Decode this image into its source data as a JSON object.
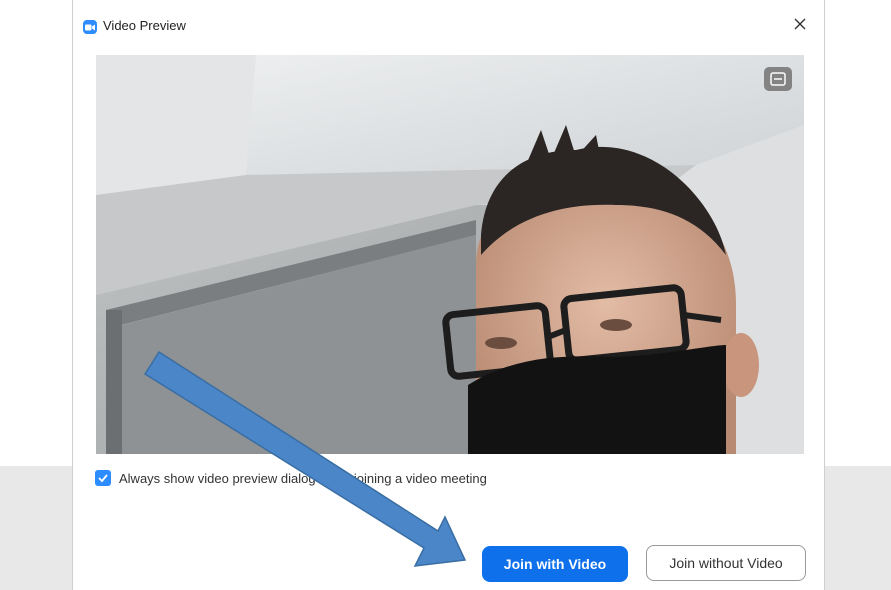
{
  "window": {
    "title": "Video Preview",
    "app_icon": "zoom-camera-icon",
    "close_icon": "close-icon"
  },
  "video_preview": {
    "toggle_icon": "layout-toggle-icon"
  },
  "options": {
    "always_show_preview_label": "Always show video preview dialog when joining a video meeting",
    "always_show_preview_checked": true
  },
  "buttons": {
    "join_with_video": "Join with Video",
    "join_without_video": "Join without Video"
  },
  "colors": {
    "primary": "#0e71eb",
    "checkbox": "#2d8cff",
    "annotation_arrow": "#4a86c8"
  }
}
